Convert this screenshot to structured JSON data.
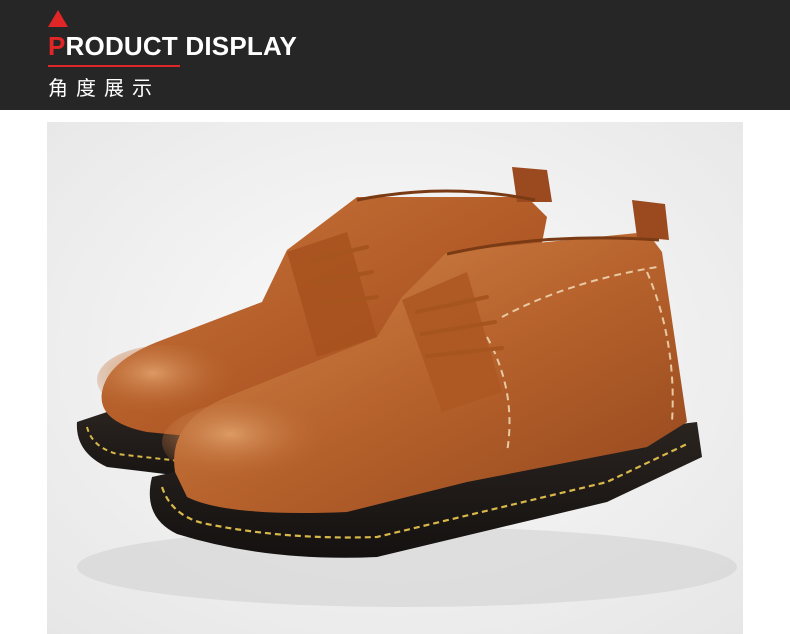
{
  "header": {
    "title_first_letter": "P",
    "title_rest": "RODUCT DISPLAY",
    "subtitle": "角度展示",
    "accent_color": "#e02626",
    "background_color": "#262626"
  },
  "product_image": {
    "subject": "pair of brown leather lace-up chukka boots",
    "leather_color": "#b5602c",
    "sole_color": "#1e1a17",
    "stitch_color": "#d9b84a"
  }
}
